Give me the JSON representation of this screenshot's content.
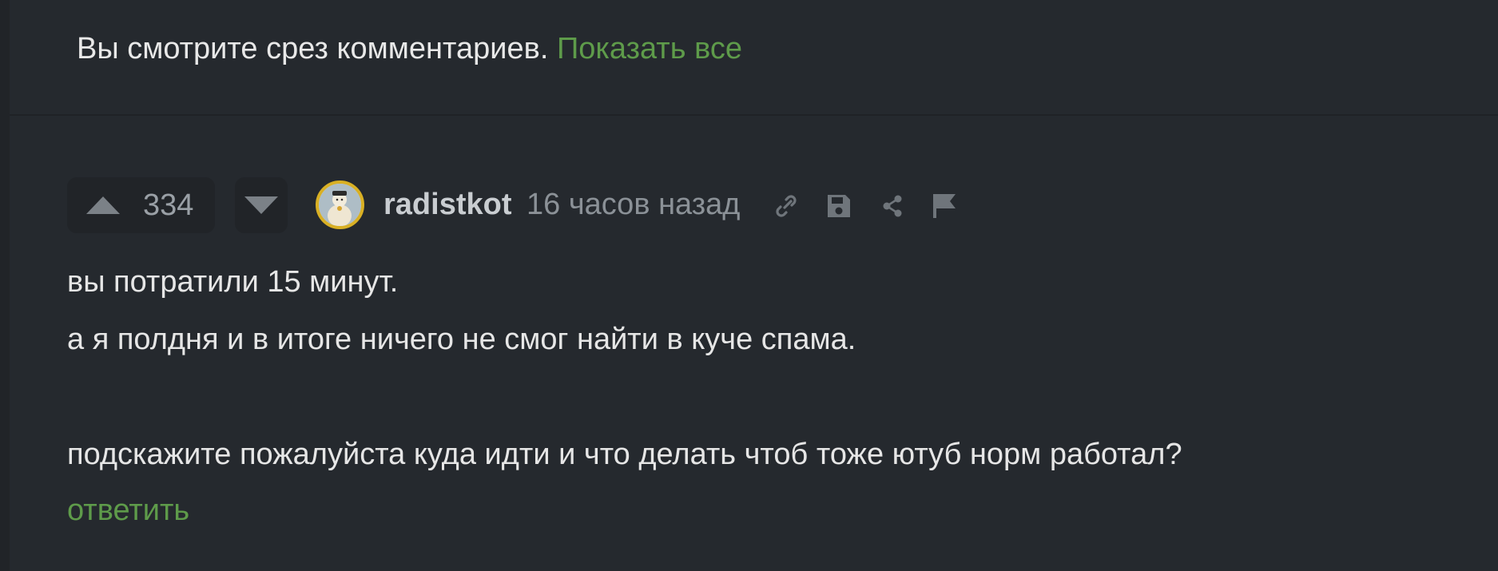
{
  "slice_notice": {
    "text": "Вы смотрите срез комментариев.",
    "link": "Показать все"
  },
  "comment": {
    "rating": "334",
    "author": "radistkot",
    "time": "16 часов назад",
    "lines": [
      "вы потратили 15 минут.",
      "а я полдня и в итоге ничего не смог найти в куче спама.",
      "",
      "подскажите пожалуйста куда идти и что делать чтоб тоже ютуб норм работал?"
    ],
    "reply_label": "ответить"
  },
  "icons": {
    "upvote": "arrow-up-icon",
    "downvote": "arrow-down-icon",
    "link": "link-icon",
    "save": "save-icon",
    "share": "share-icon",
    "report": "flag-icon"
  },
  "colors": {
    "background": "#25292e",
    "accent_green": "#5e9b4a",
    "avatar_ring": "#d9b024"
  }
}
